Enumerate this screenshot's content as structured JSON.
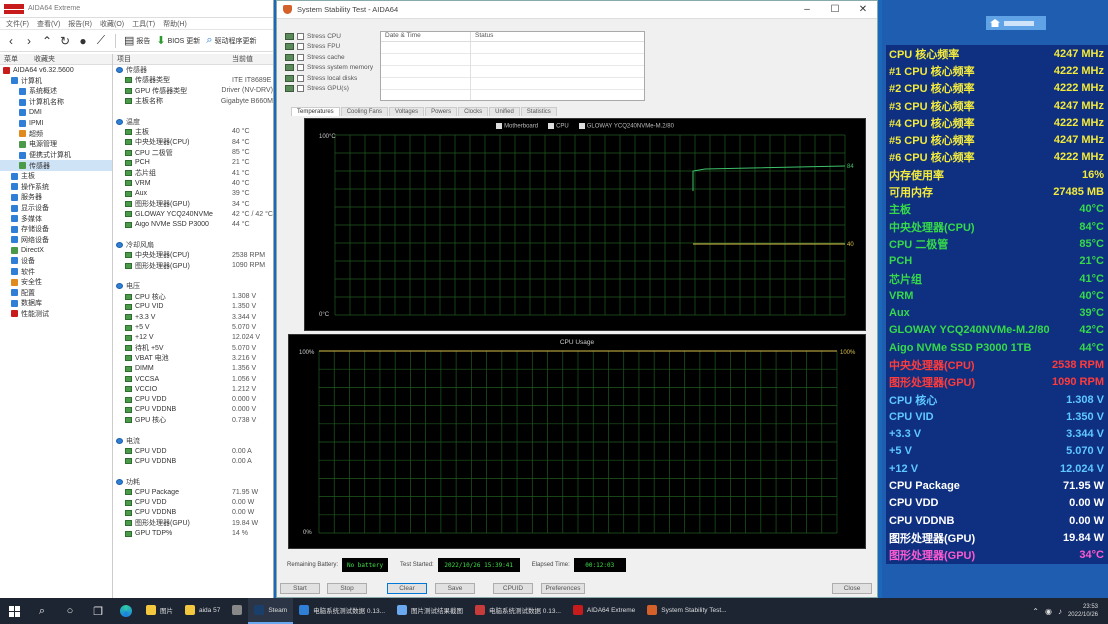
{
  "aida": {
    "title": "AIDA64 Extreme",
    "menu": [
      "文件(F)",
      "查看(V)",
      "报告(R)",
      "收藏(O)",
      "工具(T)",
      "帮助(H)"
    ],
    "toolbar": {
      "report": "报告",
      "bios_update": "BIOS 更新",
      "driver_update": "驱动程序更新"
    },
    "tree_headers": [
      "菜单",
      "收藏夹"
    ],
    "tree": [
      {
        "label": "AIDA64 v6.32.5600",
        "color": "#c81b1b",
        "indent": 0,
        "sel": false
      },
      {
        "label": "计算机",
        "color": "#2f7fd6",
        "indent": 1,
        "sel": false
      },
      {
        "label": "系统概述",
        "color": "#2f7fd6",
        "indent": 2,
        "sel": false
      },
      {
        "label": "计算机名称",
        "color": "#2f7fd6",
        "indent": 2,
        "sel": false
      },
      {
        "label": "DMI",
        "color": "#2f7fd6",
        "indent": 2,
        "sel": false
      },
      {
        "label": "IPMI",
        "color": "#2f7fd6",
        "indent": 2,
        "sel": false
      },
      {
        "label": "超频",
        "color": "#e08a1e",
        "indent": 2,
        "sel": false
      },
      {
        "label": "电源管理",
        "color": "#4a9a4a",
        "indent": 2,
        "sel": false
      },
      {
        "label": "便携式计算机",
        "color": "#2f7fd6",
        "indent": 2,
        "sel": false
      },
      {
        "label": "传感器",
        "color": "#4a9a4a",
        "indent": 2,
        "sel": true
      },
      {
        "label": "主板",
        "color": "#2f7fd6",
        "indent": 1,
        "sel": false
      },
      {
        "label": "操作系统",
        "color": "#2f7fd6",
        "indent": 1,
        "sel": false
      },
      {
        "label": "服务器",
        "color": "#2f7fd6",
        "indent": 1,
        "sel": false
      },
      {
        "label": "显示设备",
        "color": "#2f7fd6",
        "indent": 1,
        "sel": false
      },
      {
        "label": "多媒体",
        "color": "#2f7fd6",
        "indent": 1,
        "sel": false
      },
      {
        "label": "存储设备",
        "color": "#2f7fd6",
        "indent": 1,
        "sel": false
      },
      {
        "label": "网络设备",
        "color": "#2f7fd6",
        "indent": 1,
        "sel": false
      },
      {
        "label": "DirectX",
        "color": "#4a9a4a",
        "indent": 1,
        "sel": false
      },
      {
        "label": "设备",
        "color": "#2f7fd6",
        "indent": 1,
        "sel": false
      },
      {
        "label": "软件",
        "color": "#2f7fd6",
        "indent": 1,
        "sel": false
      },
      {
        "label": "安全性",
        "color": "#e08a1e",
        "indent": 1,
        "sel": false
      },
      {
        "label": "配置",
        "color": "#2f7fd6",
        "indent": 1,
        "sel": false
      },
      {
        "label": "数据库",
        "color": "#2f7fd6",
        "indent": 1,
        "sel": false
      },
      {
        "label": "性能测试",
        "color": "#c81b1b",
        "indent": 1,
        "sel": false
      }
    ],
    "list_headers": [
      "项目",
      "当前值"
    ],
    "rows": [
      {
        "k": "传感器",
        "v": "",
        "g": true
      },
      {
        "k": "传感器类型",
        "v": "ITE IT8689E",
        "g": false
      },
      {
        "k": "GPU 传感器类型",
        "v": "Driver (NV-DRV)",
        "g": false
      },
      {
        "k": "主板名称",
        "v": "Gigabyte B660M",
        "g": false
      },
      {
        "k": "",
        "v": "",
        "blank": true
      },
      {
        "k": "温度",
        "v": "",
        "g": true
      },
      {
        "k": "主板",
        "v": "40 °C",
        "g": false
      },
      {
        "k": "中央处理器(CPU)",
        "v": "84 °C",
        "g": false
      },
      {
        "k": "CPU 二极管",
        "v": "85 °C",
        "g": false
      },
      {
        "k": "PCH",
        "v": "21 °C",
        "g": false
      },
      {
        "k": "芯片组",
        "v": "41 °C",
        "g": false
      },
      {
        "k": "VRM",
        "v": "40 °C",
        "g": false
      },
      {
        "k": "Aux",
        "v": "39 °C",
        "g": false
      },
      {
        "k": "图形处理器(GPU)",
        "v": "34 °C",
        "g": false
      },
      {
        "k": "GLOWAY YCQ240NVMe",
        "v": "42 °C / 42 °C",
        "g": false
      },
      {
        "k": "Aigo NVMe SSD P3000",
        "v": "44 °C",
        "g": false
      },
      {
        "k": "",
        "v": "",
        "blank": true
      },
      {
        "k": "冷却风扇",
        "v": "",
        "g": true
      },
      {
        "k": "中央处理器(CPU)",
        "v": "2538 RPM",
        "g": false
      },
      {
        "k": "图形处理器(GPU)",
        "v": "1090 RPM",
        "g": false
      },
      {
        "k": "",
        "v": "",
        "blank": true
      },
      {
        "k": "电压",
        "v": "",
        "g": true
      },
      {
        "k": "CPU 核心",
        "v": "1.308 V",
        "g": false
      },
      {
        "k": "CPU VID",
        "v": "1.350 V",
        "g": false
      },
      {
        "k": "+3.3 V",
        "v": "3.344 V",
        "g": false
      },
      {
        "k": "+5 V",
        "v": "5.070 V",
        "g": false
      },
      {
        "k": "+12 V",
        "v": "12.024 V",
        "g": false
      },
      {
        "k": "待机 +5V",
        "v": "5.070 V",
        "g": false
      },
      {
        "k": "VBAT 电池",
        "v": "3.216 V",
        "g": false
      },
      {
        "k": "DIMM",
        "v": "1.356 V",
        "g": false
      },
      {
        "k": "VCCSA",
        "v": "1.056 V",
        "g": false
      },
      {
        "k": "VCCIO",
        "v": "1.212 V",
        "g": false
      },
      {
        "k": "CPU VDD",
        "v": "0.000 V",
        "g": false
      },
      {
        "k": "CPU VDDNB",
        "v": "0.000 V",
        "g": false
      },
      {
        "k": "GPU 核心",
        "v": "0.738 V",
        "g": false
      },
      {
        "k": "",
        "v": "",
        "blank": true
      },
      {
        "k": "电流",
        "v": "",
        "g": true
      },
      {
        "k": "CPU VDD",
        "v": "0.00 A",
        "g": false
      },
      {
        "k": "CPU VDDNB",
        "v": "0.00 A",
        "g": false
      },
      {
        "k": "",
        "v": "",
        "blank": true
      },
      {
        "k": "功耗",
        "v": "",
        "g": true
      },
      {
        "k": "CPU Package",
        "v": "71.95 W",
        "g": false
      },
      {
        "k": "CPU VDD",
        "v": "0.00 W",
        "g": false
      },
      {
        "k": "CPU VDDNB",
        "v": "0.00 W",
        "g": false
      },
      {
        "k": "图形处理器(GPU)",
        "v": "19.84 W",
        "g": false
      },
      {
        "k": "GPU TDP%",
        "v": "14 %",
        "g": false
      }
    ]
  },
  "sst": {
    "title": "System Stability Test - AIDA64",
    "tests": [
      "Stress CPU",
      "Stress FPU",
      "Stress cache",
      "Stress system memory",
      "Stress local disks",
      "Stress GPU(s)"
    ],
    "log_headers": [
      "Date & Time",
      "Status"
    ],
    "tabs": [
      "Temperatures",
      "Cooling Fans",
      "Voltages",
      "Powers",
      "Clocks",
      "Unified",
      "Statistics"
    ],
    "chart1": {
      "legend": [
        "Motherboard",
        "CPU",
        "GLOWAY YCQ240NVMe-M.2/80"
      ],
      "ymax": "100°C",
      "ymin": "0°C",
      "val1": "84",
      "val2": "40"
    },
    "chart2": {
      "title": "CPU Usage",
      "ymax": "100%",
      "ymin": "0%",
      "val": "100%"
    },
    "status": {
      "battery_label": "Remaining Battery:",
      "battery": "No battery",
      "started_label": "Test Started:",
      "started": "2022/10/26 15:39:41",
      "elapsed_label": "Elapsed Time:",
      "elapsed": "00:12:03"
    },
    "buttons": [
      "Start",
      "Stop",
      "Clear",
      "Save",
      "CPUID",
      "Preferences",
      "Close"
    ]
  },
  "osd": [
    {
      "l": "CPU 核心频率",
      "v": "4247 MHz",
      "c": "#f2ea3c"
    },
    {
      "l": "#1 CPU 核心频率",
      "v": "4222 MHz",
      "c": "#f2ea3c"
    },
    {
      "l": "#2 CPU 核心频率",
      "v": "4222 MHz",
      "c": "#f2ea3c"
    },
    {
      "l": "#3 CPU 核心频率",
      "v": "4247 MHz",
      "c": "#f2ea3c"
    },
    {
      "l": "#4 CPU 核心频率",
      "v": "4222 MHz",
      "c": "#f2ea3c"
    },
    {
      "l": "#5 CPU 核心频率",
      "v": "4247 MHz",
      "c": "#f2ea3c"
    },
    {
      "l": "#6 CPU 核心频率",
      "v": "4222 MHz",
      "c": "#f2ea3c"
    },
    {
      "l": "内存使用率",
      "v": "16%",
      "c": "#f2ea3c"
    },
    {
      "l": "可用内存",
      "v": "27485 MB",
      "c": "#f2ea3c"
    },
    {
      "l": "主板",
      "v": "40°C",
      "c": "#35d94a"
    },
    {
      "l": "中央处理器(CPU)",
      "v": "84°C",
      "c": "#35d94a"
    },
    {
      "l": "CPU 二极管",
      "v": "85°C",
      "c": "#35d94a"
    },
    {
      "l": "PCH",
      "v": "21°C",
      "c": "#35d94a"
    },
    {
      "l": "芯片组",
      "v": "41°C",
      "c": "#35d94a"
    },
    {
      "l": "VRM",
      "v": "40°C",
      "c": "#35d94a"
    },
    {
      "l": "Aux",
      "v": "39°C",
      "c": "#35d94a"
    },
    {
      "l": "GLOWAY YCQ240NVMe-M.2/80",
      "v": "42°C",
      "c": "#35d94a"
    },
    {
      "l": "Aigo NVMe SSD P3000 1TB",
      "v": "44°C",
      "c": "#35d94a"
    },
    {
      "l": "中央处理器(CPU)",
      "v": "2538 RPM",
      "c": "#ff3b3b"
    },
    {
      "l": "图形处理器(GPU)",
      "v": "1090 RPM",
      "c": "#ff3b3b"
    },
    {
      "l": "CPU 核心",
      "v": "1.308 V",
      "c": "#5ec8ff"
    },
    {
      "l": "CPU VID",
      "v": "1.350 V",
      "c": "#5ec8ff"
    },
    {
      "l": "+3.3 V",
      "v": "3.344 V",
      "c": "#5ec8ff"
    },
    {
      "l": "+5 V",
      "v": "5.070 V",
      "c": "#5ec8ff"
    },
    {
      "l": "+12 V",
      "v": "12.024 V",
      "c": "#5ec8ff"
    },
    {
      "l": "CPU Package",
      "v": "71.95 W",
      "c": "#ffffff"
    },
    {
      "l": "CPU VDD",
      "v": "0.00 W",
      "c": "#ffffff"
    },
    {
      "l": "CPU VDDNB",
      "v": "0.00 W",
      "c": "#ffffff"
    },
    {
      "l": "图形处理器(GPU)",
      "v": "19.84 W",
      "c": "#ffffff"
    },
    {
      "l": "图形处理器(GPU)",
      "v": "34°C",
      "c": "#ff5ad0"
    }
  ],
  "taskbar": {
    "tasks": [
      {
        "label": "图片",
        "color": "#f3c83e",
        "active": false
      },
      {
        "label": "aida 57",
        "color": "#f3c83e",
        "active": false
      },
      {
        "label": "",
        "color": "#888888",
        "active": false
      },
      {
        "label": "Steam",
        "color": "#1b3f6b",
        "active": true
      },
      {
        "label": "电脑系统测试数据 0.13...",
        "color": "#2f7fd6",
        "active": false
      },
      {
        "label": "图片测试结果截图",
        "color": "#6aa8f0",
        "active": false
      },
      {
        "label": "电脑系统测试数据 0.13...",
        "color": "#c83b3b",
        "active": false
      },
      {
        "label": "AIDA64 Extreme",
        "color": "#c81b1b",
        "active": false
      },
      {
        "label": "System Stability Test...",
        "color": "#d4602a",
        "active": false
      }
    ],
    "time": "23:53",
    "date": "2022/10/26"
  }
}
